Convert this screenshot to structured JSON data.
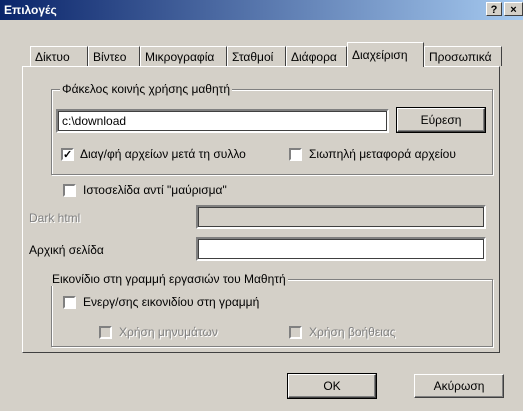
{
  "window": {
    "title": "Επιλογές",
    "help_glyph": "?",
    "close_glyph": "×"
  },
  "tabs": [
    {
      "label": "Δίκτυο"
    },
    {
      "label": "Βίντεο"
    },
    {
      "label": "Μικρογραφία"
    },
    {
      "label": "Σταθμοί"
    },
    {
      "label": "Διάφορα"
    },
    {
      "label": "Διαχείριση",
      "active": true
    },
    {
      "label": "Προσωπικά"
    }
  ],
  "shared_folder": {
    "group_title": "Φάκελος κοινής χρήσης μαθητή",
    "path_value": "c:\\download",
    "browse_label": "Εύρεση",
    "delete_after_collect": {
      "label": "Διαγ/φή αρχείων μετά τη συλλο",
      "checked": true
    },
    "silent_transfer": {
      "label": "Σιωπηλή μεταφορά αρχείου",
      "checked": false
    }
  },
  "webpage_instead_blackout": {
    "label": "Ιστοσελίδα αντί \"μαύρισμα\"",
    "checked": false
  },
  "dark_html": {
    "label": "Dark html",
    "value": "",
    "enabled": false
  },
  "home_page": {
    "label": "Αρχική σελίδα",
    "value": ""
  },
  "taskbar_icon": {
    "group_title": "Εικονίδιο στη γραμμή εργασιών του Μαθητή",
    "enable_icon": {
      "label": "Ενεργ/σης εικονιδίου στη γραμμή",
      "checked": false
    },
    "use_messages": {
      "label": "Χρήση μηνυμάτων",
      "checked": false,
      "enabled": false
    },
    "use_help": {
      "label": "Χρήση βοήθειας",
      "checked": false,
      "enabled": false
    }
  },
  "footer": {
    "ok_label": "OK",
    "cancel_label": "Ακύρωση"
  }
}
